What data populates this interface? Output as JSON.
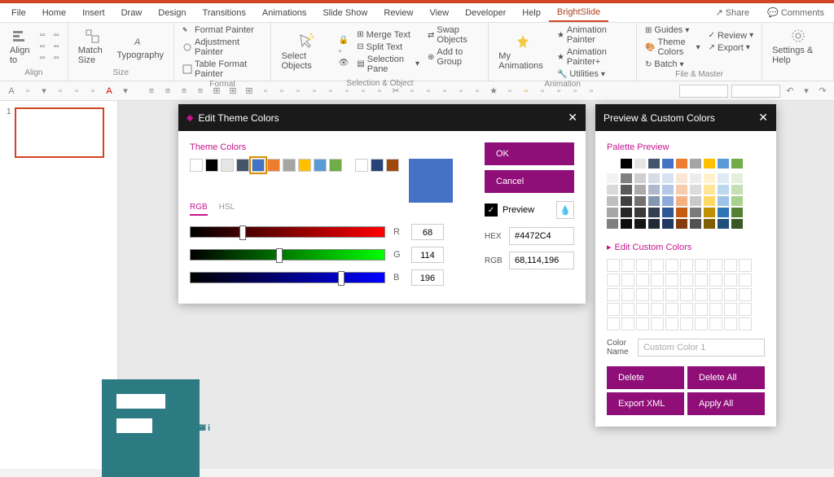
{
  "menubar": {
    "tabs": [
      "File",
      "Home",
      "Insert",
      "Draw",
      "Design",
      "Transitions",
      "Animations",
      "Slide Show",
      "Review",
      "View",
      "Developer",
      "Help",
      "BrightSlide"
    ],
    "active": 12,
    "share": "Share",
    "comments": "Comments"
  },
  "ribbon": {
    "align": {
      "label": "Align",
      "btn": "Align to"
    },
    "size": {
      "label": "Size",
      "match": "Match Size",
      "typo": "Typography"
    },
    "format": {
      "label": "Format",
      "p1": "Format Painter",
      "p2": "Adjustment Painter",
      "p3": "Table Format Painter"
    },
    "selobj": {
      "label": "Selection & Object",
      "sel": "Select Objects",
      "merge": "Merge Text",
      "swap": "Swap Objects",
      "split": "Split Text",
      "addg": "Add to Group",
      "pane": "Selection Pane"
    },
    "anim": {
      "label": "Animation",
      "my": "My Animations",
      "ap": "Animation Painter",
      "app": "Animation Painter+",
      "util": "Utilities"
    },
    "fm": {
      "label": "File & Master",
      "guides": "Guides",
      "theme": "Theme Colors",
      "batch": "Batch",
      "review": "Review",
      "export": "Export"
    },
    "settings": {
      "label": "",
      "set": "Settings & Help"
    }
  },
  "thumb": {
    "num": "1"
  },
  "editDialog": {
    "title": "Edit Theme Colors",
    "themeColors": "Theme Colors",
    "rgb": "RGB",
    "hsl": "HSL",
    "r": "R",
    "g": "G",
    "b": "B",
    "rVal": "68",
    "gVal": "114",
    "bVal": "196",
    "ok": "OK",
    "cancel": "Cancel",
    "preview": "Preview",
    "hexLabel": "HEX",
    "hexVal": "#4472C4",
    "rgbLabel": "RGB",
    "rgbVal": "68,114,196",
    "swatches": [
      "#ffffff",
      "#000000",
      "#e7e6e6",
      "#44546a",
      "#4472c4",
      "#ed7d31",
      "#a5a5a5",
      "#ffc000",
      "#5b9bd5",
      "#70ad47",
      "#ffffff",
      "#264478",
      "#9e480e"
    ],
    "selectedIdx": 4,
    "bigSwatch": "#4472c4"
  },
  "previewDialog": {
    "title": "Preview & Custom Colors",
    "palette": "Palette Preview",
    "editCustom": "Edit Custom Colors",
    "colorName": "Color Name",
    "colorNameVal": "Custom Color 1",
    "delete": "Delete",
    "deleteAll": "Delete All",
    "exportXml": "Export XML",
    "applyAll": "Apply All",
    "cols": [
      [
        "#ffffff",
        "#f2f2f2",
        "#d9d9d9",
        "#bfbfbf",
        "#a6a6a6",
        "#7f7f7f"
      ],
      [
        "#000000",
        "#7f7f7f",
        "#595959",
        "#404040",
        "#262626",
        "#0d0d0d"
      ],
      [
        "#e7e6e6",
        "#d0cece",
        "#aeaaaa",
        "#757171",
        "#3b3838",
        "#161616"
      ],
      [
        "#44546a",
        "#d6dce5",
        "#adb9ca",
        "#8497b0",
        "#333f50",
        "#222a35"
      ],
      [
        "#4472c4",
        "#d9e2f3",
        "#b4c7e7",
        "#8eaadb",
        "#2f5597",
        "#1f3864"
      ],
      [
        "#ed7d31",
        "#fbe5d6",
        "#f8cbad",
        "#f4b183",
        "#c55a11",
        "#843c0c"
      ],
      [
        "#a5a5a5",
        "#ededed",
        "#dbdbdb",
        "#c9c9c9",
        "#7b7b7b",
        "#525252"
      ],
      [
        "#ffc000",
        "#fff2cc",
        "#ffe699",
        "#ffd966",
        "#bf9000",
        "#7f6000"
      ],
      [
        "#5b9bd5",
        "#deebf7",
        "#bdd7ee",
        "#9dc3e6",
        "#2e75b6",
        "#1f4e79"
      ],
      [
        "#70ad47",
        "#e2f0d9",
        "#c5e0b4",
        "#a9d18e",
        "#548235",
        "#385723"
      ]
    ]
  },
  "watermark": "ileCR"
}
